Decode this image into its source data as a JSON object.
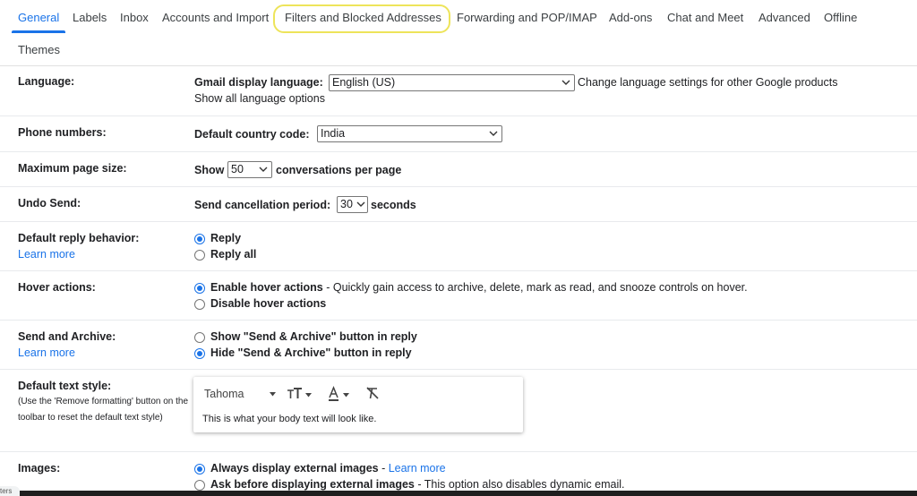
{
  "tabs": {
    "items": [
      {
        "label": "General",
        "active": true
      },
      {
        "label": "Labels"
      },
      {
        "label": "Inbox"
      },
      {
        "label": "Accounts and Import"
      },
      {
        "label": "Filters and Blocked Addresses",
        "highlighted": true
      },
      {
        "label": "Forwarding and POP/IMAP"
      },
      {
        "label": "Add-ons"
      },
      {
        "label": "Chat and Meet"
      },
      {
        "label": "Advanced"
      },
      {
        "label": "Offline"
      },
      {
        "label": "Themes"
      }
    ],
    "accent_color": "#1a73e8",
    "highlight_color": "#ede45a"
  },
  "language": {
    "label": "Language:",
    "field_label": "Gmail display language:",
    "selected": "English (US)",
    "change_link": "Change language settings for other Google products",
    "show_all_link": "Show all language options"
  },
  "phone": {
    "label": "Phone numbers:",
    "field_label": "Default country code:",
    "selected": "India"
  },
  "page_size": {
    "label": "Maximum page size:",
    "prefix": "Show",
    "selected": "50",
    "suffix": "conversations per page"
  },
  "undo_send": {
    "label": "Undo Send:",
    "field_label": "Send cancellation period:",
    "selected": "30",
    "suffix": "seconds"
  },
  "reply_behavior": {
    "label": "Default reply behavior:",
    "learn_more": "Learn more",
    "options": [
      {
        "label": "Reply",
        "checked": true
      },
      {
        "label": "Reply all",
        "checked": false
      }
    ]
  },
  "hover_actions": {
    "label": "Hover actions:",
    "options": [
      {
        "label": "Enable hover actions",
        "detail": " - Quickly gain access to archive, delete, mark as read, and snooze controls on hover.",
        "checked": true
      },
      {
        "label": "Disable hover actions",
        "checked": false
      }
    ]
  },
  "send_archive": {
    "label": "Send and Archive:",
    "learn_more": "Learn more",
    "options": [
      {
        "label": "Show \"Send & Archive\" button in reply",
        "checked": false
      },
      {
        "label": "Hide \"Send & Archive\" button in reply",
        "checked": true
      }
    ]
  },
  "text_style": {
    "label": "Default text style:",
    "hint": "(Use the 'Remove formatting' button on the toolbar to reset the default text style)",
    "font": "Tahoma",
    "preview": "This is what your body text will look like."
  },
  "images": {
    "label": "Images:",
    "options": [
      {
        "label": "Always display external images",
        "detail": " - ",
        "link": "Learn more",
        "checked": true
      },
      {
        "label": "Ask before displaying external images",
        "detail": " - This option also disables dynamic email.",
        "checked": false
      }
    ]
  },
  "corner_tag": "ters"
}
